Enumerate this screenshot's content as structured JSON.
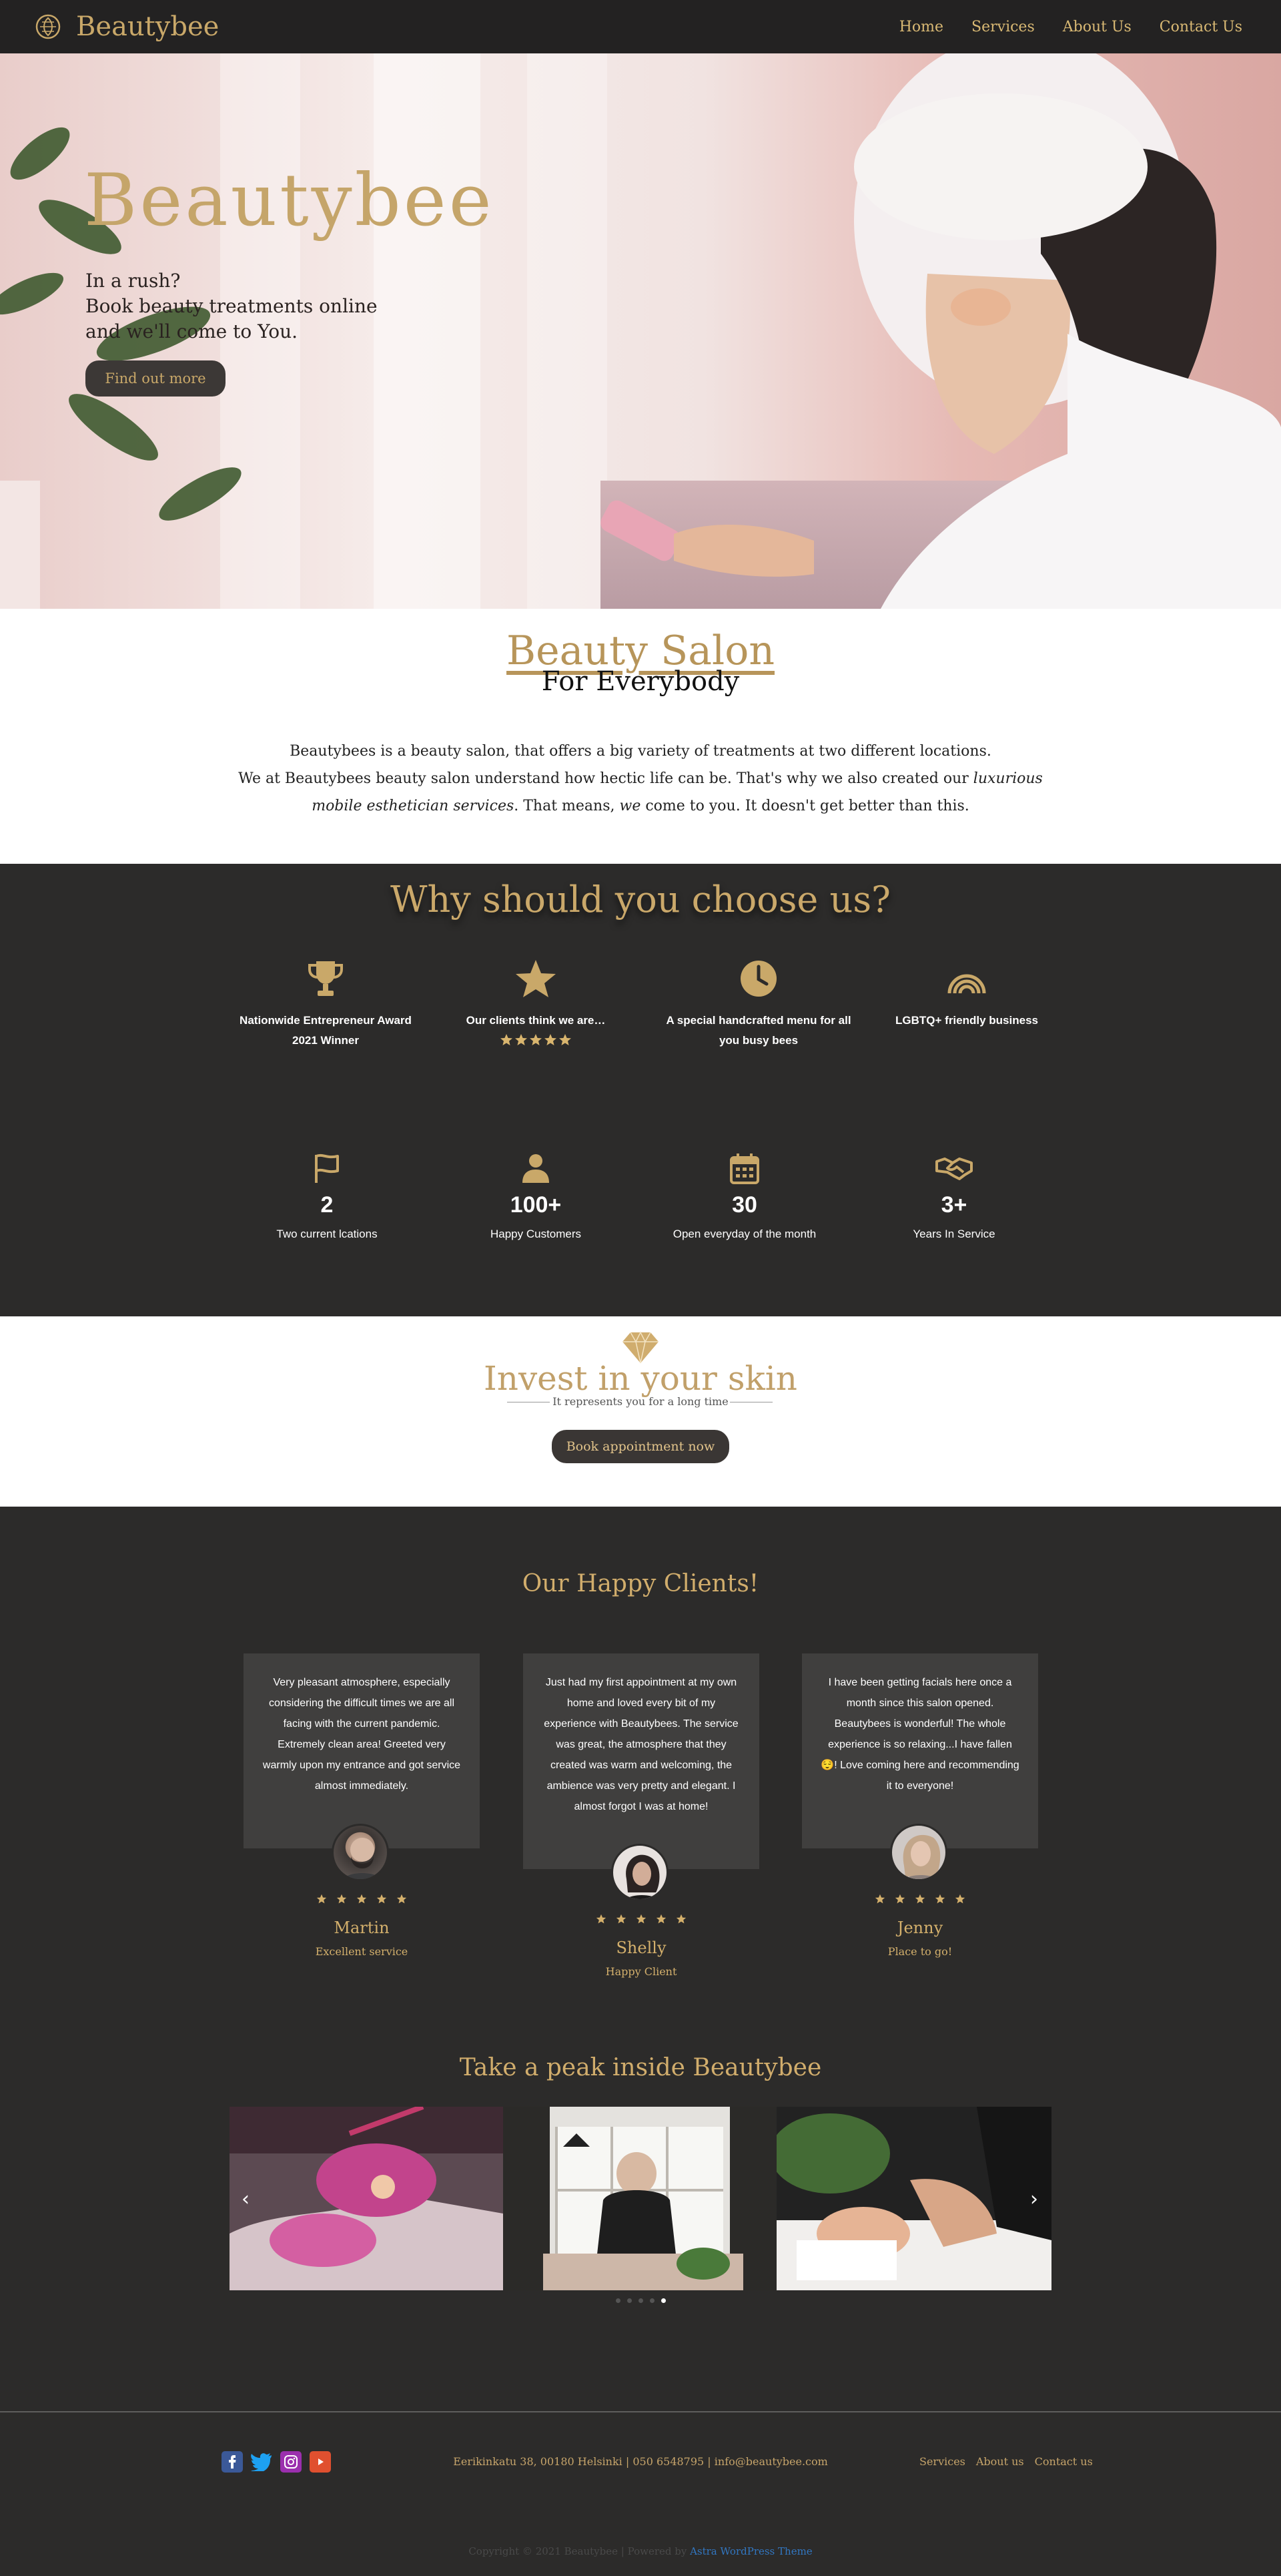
{
  "header": {
    "brand": "Beautybee",
    "nav": [
      "Home",
      "Services",
      "About Us",
      "Contact Us"
    ]
  },
  "hero": {
    "title": "Beautybee",
    "lines": [
      "In a rush?",
      "Book beauty treatments online",
      "and we'll come to You."
    ],
    "button": "Find out more"
  },
  "salon": {
    "title": "Beauty Salon",
    "subtitle": "For Everybody",
    "p1": "Beautybees is a beauty salon, that offers a big variety of treatments at two different locations.",
    "p2a": "We at Beautybees beauty salon understand how hectic life can be. That's why we also created our ",
    "p2em": "luxurious mobile esthetician services",
    "p2b": ". That means, ",
    "p2em2": "we",
    "p2c": " come to you. It doesn't get better than this."
  },
  "why": {
    "title": "Why should you choose us?",
    "features": [
      {
        "icon": "trophy-icon",
        "label": "Nationwide Entrepreneur Award 2021 Winner"
      },
      {
        "icon": "star-icon",
        "label": "Our clients think we are…",
        "rating": 5
      },
      {
        "icon": "clock-icon",
        "label": "A special handcrafted menu for all you busy bees"
      },
      {
        "icon": "rainbow-icon",
        "label": "LGBTQ+ friendly business"
      }
    ],
    "stats": [
      {
        "icon": "flag-icon",
        "value": "2",
        "label": "Two current lcations"
      },
      {
        "icon": "user-icon",
        "value": "100+",
        "label": "Happy Customers"
      },
      {
        "icon": "calendar-icon",
        "value": "30",
        "label": "Open everyday of the month"
      },
      {
        "icon": "handshake-icon",
        "value": "3+",
        "label": "Years In Service"
      }
    ]
  },
  "invest": {
    "icon": "diamond-icon",
    "title": "Invest in your skin",
    "subtitle": "It represents you for a long time",
    "button": "Book appointment now"
  },
  "clients": {
    "title": "Our Happy Clients!",
    "testimonials": [
      {
        "text": "Very pleasant atmosphere, especially considering the difficult times we are all facing with the current pandemic. Extremely clean area! Greeted very warmly upon my entrance and got service almost immediately.",
        "name": "Martin",
        "role": "Excellent service",
        "rating": 5
      },
      {
        "text": "Just had my first appointment at my own home and loved every bit of my experience with Beautybees. The service was great, the atmosphere that they created was warm and welcoming, the ambience was very pretty and elegant. I almost forgot I was at home!",
        "name": "Shelly",
        "role": "Happy Client",
        "rating": 5
      },
      {
        "text": "I have been getting facials here once a month since this salon opened. Beautybees is wonderful! The whole experience is so relaxing...I have fallen 😌! Love coming here and recommending it to everyone!",
        "name": "Jenny",
        "role": "Place to go!",
        "rating": 5
      }
    ]
  },
  "gallery": {
    "title": "Take a peak inside Beautybee",
    "prev": "‹",
    "next": "›",
    "slides": 5,
    "active": 5
  },
  "footer": {
    "address": "Eerikinkatu 38, 00180 Helsinki | 050 6548795 | info@beautybee.com",
    "nav": [
      "Services",
      "About us",
      "Contact us"
    ],
    "copyright_prefix": "Copyright © 2021 Beautybee | Powered by ",
    "copyright_link": "Astra WordPress Theme",
    "socials": [
      "facebook-icon",
      "twitter-icon",
      "instagram-icon",
      "youtube-icon"
    ]
  },
  "colors": {
    "gold": "#c9a869",
    "dark": "#2c2b2a",
    "header": "#232222"
  }
}
